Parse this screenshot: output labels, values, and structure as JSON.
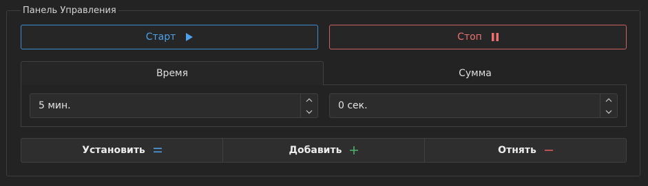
{
  "panel": {
    "title": "Панель Управления"
  },
  "controls": {
    "start_label": "Старт",
    "stop_label": "Стоп",
    "start_icon": "play-icon",
    "stop_icon": "pause-icon",
    "start_color": "#4da3ea",
    "stop_color": "#ee7070"
  },
  "tabs": [
    {
      "label": "Время",
      "active": true
    },
    {
      "label": "Сумма",
      "active": false
    }
  ],
  "inputs": {
    "time_value": "5 мин.",
    "sum_value": "0 сек."
  },
  "actions": [
    {
      "label": "Установить",
      "icon": "equals-icon",
      "color": "#4da3ea"
    },
    {
      "label": "Добавить",
      "icon": "plus-icon",
      "color": "#4caf6a"
    },
    {
      "label": "Отнять",
      "icon": "minus-icon",
      "color": "#e05c5c"
    }
  ]
}
